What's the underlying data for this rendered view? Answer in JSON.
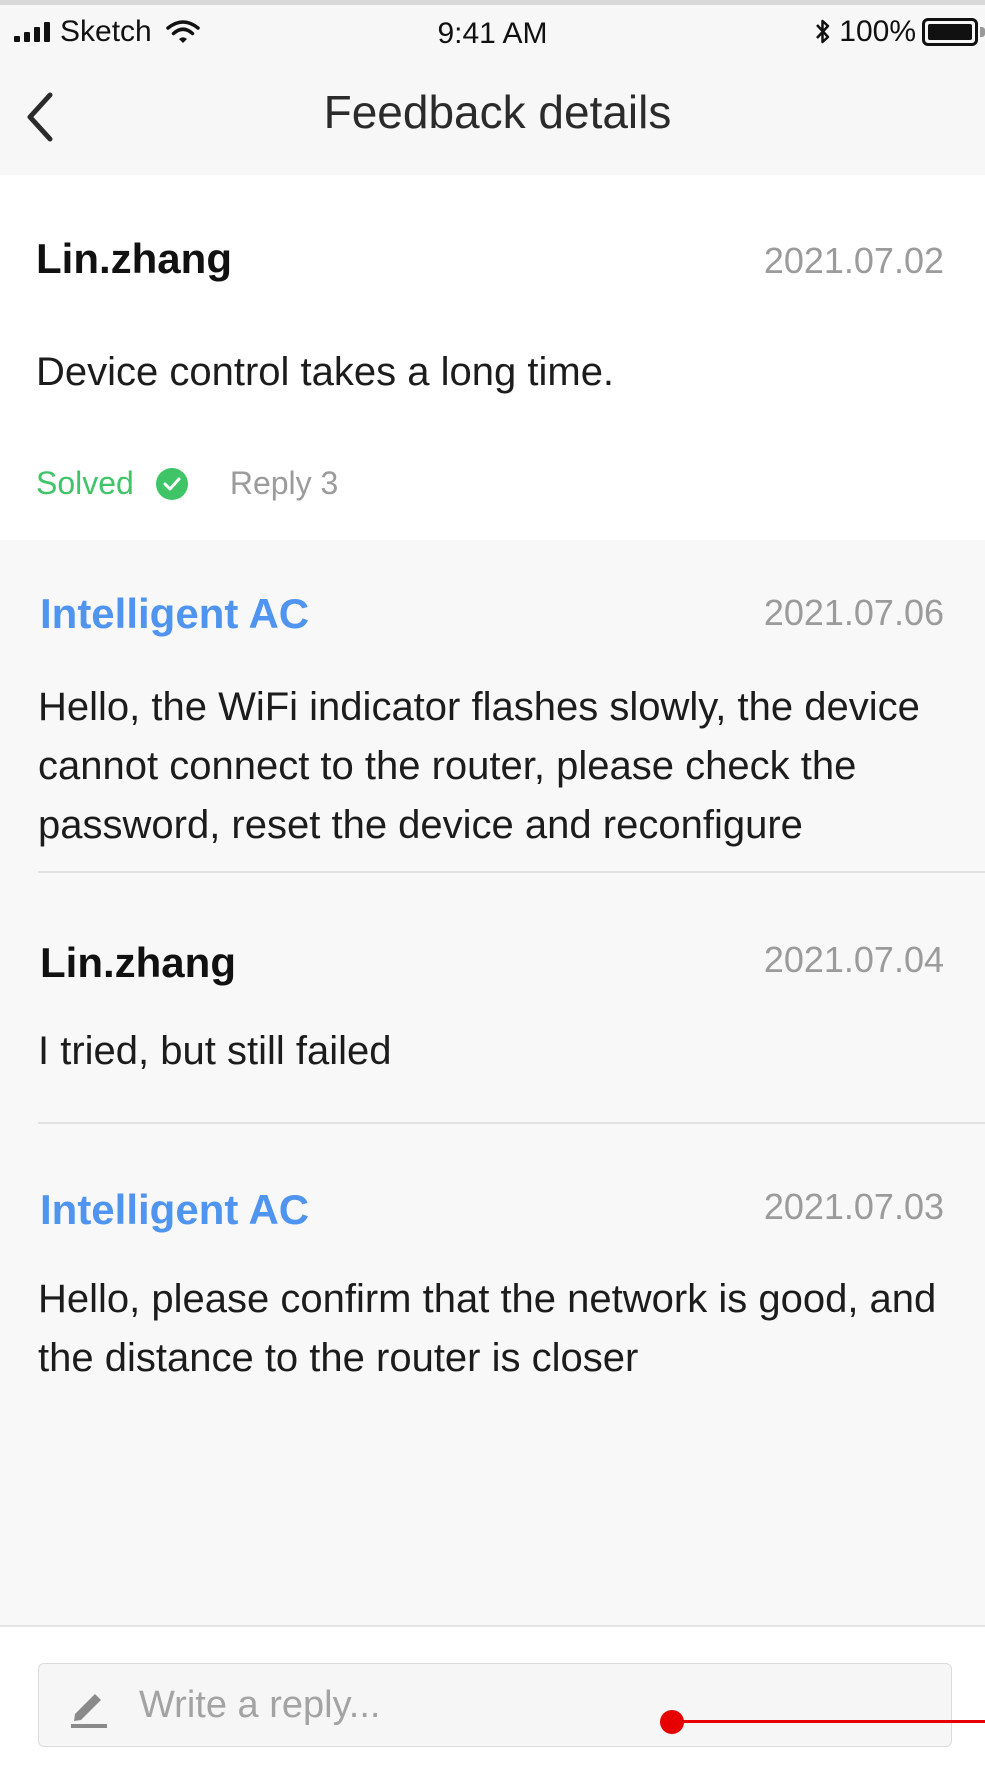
{
  "status_bar": {
    "carrier": "Sketch",
    "time": "9:41 AM",
    "battery": "100%",
    "signal_icon": "signal-icon",
    "wifi_icon": "wifi-icon",
    "bluetooth_icon": "bluetooth-icon",
    "battery_icon": "battery-icon",
    "battery_level": 1.0
  },
  "nav": {
    "title": "Feedback details",
    "back_icon": "chevron-left-icon"
  },
  "feedback": {
    "author": "Lin.zhang",
    "date": "2021.07.02",
    "text": "Device control takes a long time.",
    "status": "Solved",
    "status_icon": "check-circle-icon",
    "replies": "Reply 3"
  },
  "thread": [
    {
      "author": "Intelligent AC",
      "date": "2021.07.06",
      "text": "Hello, the WiFi indicator flashes slowly, the device cannot connect to the router, please check the password, reset the device and reconfigure"
    },
    {
      "author": "Lin.zhang",
      "date": "2021.07.04",
      "text": "I tried, but still failed"
    },
    {
      "author": "Intelligent AC",
      "date": "2021.07.03",
      "text": "Hello, please confirm that the network is good, and the distance to the router is closer"
    }
  ],
  "composer": {
    "placeholder": "Write a reply...",
    "icon": "pencil-icon"
  },
  "colors": {
    "accent_blue": "#4f94ef",
    "solved_green": "#3fc567",
    "muted_text": "#9b9b9b",
    "thread_bg": "#f8f8f8",
    "annotation_red": "#e60000"
  }
}
